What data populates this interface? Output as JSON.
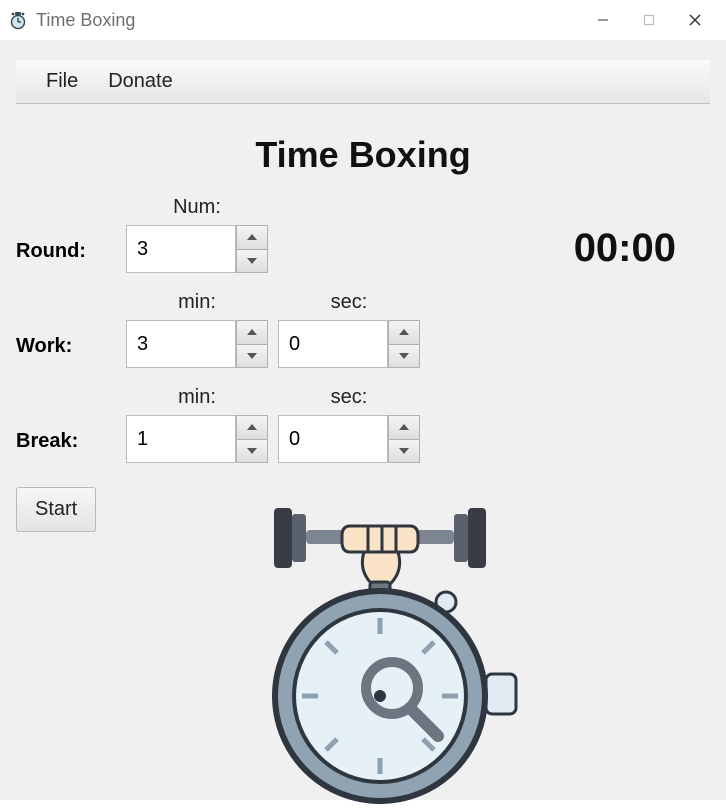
{
  "window": {
    "title": "Time Boxing"
  },
  "menubar": {
    "file": "File",
    "donate": "Donate"
  },
  "heading": "Time Boxing",
  "labels": {
    "round": "Round:",
    "work": "Work:",
    "break": "Break:",
    "num": "Num:",
    "min": "min:",
    "sec": "sec:"
  },
  "values": {
    "round_num": "3",
    "work_min": "3",
    "work_sec": "0",
    "break_min": "1",
    "break_sec": "0"
  },
  "timer": "00:00",
  "buttons": {
    "start": "Start"
  }
}
